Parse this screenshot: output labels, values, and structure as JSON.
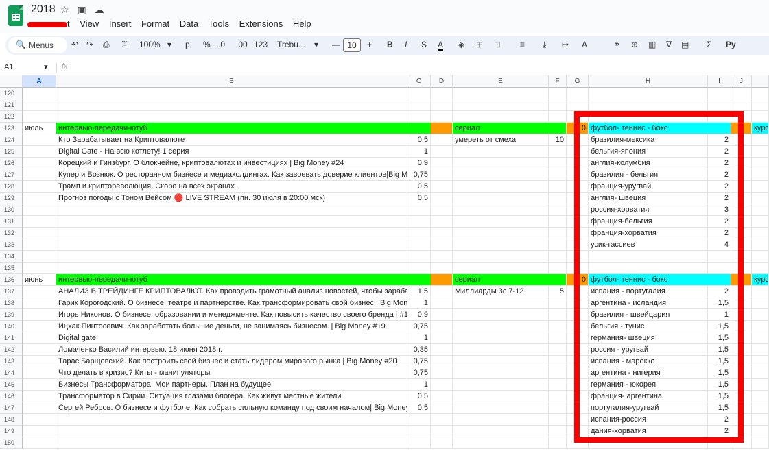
{
  "app": {
    "title": "2018",
    "menus": [
      "t",
      "View",
      "Insert",
      "Format",
      "Data",
      "Tools",
      "Extensions",
      "Help"
    ]
  },
  "toolbar": {
    "search": "Menus",
    "zoom": "100%",
    "p": "р.",
    "percent": "%",
    "dec_dn": ".0",
    "dec_up": ".00",
    "fmt123": "123",
    "font": "Trebu...",
    "font_size": "10",
    "bold": "B",
    "italic": "I",
    "strike": "S",
    "sum": "Σ",
    "lang": "Ру"
  },
  "formula_bar": {
    "cell_ref": "A1",
    "fx": "fx"
  },
  "col_headers": [
    "A",
    "B",
    "C",
    "D",
    "E",
    "F",
    "G",
    "H",
    "I",
    "J"
  ],
  "colors": {
    "green": "#00ff00",
    "orange": "#ff9900",
    "cyan": "#00ffff",
    "highlight": "#ff0000"
  },
  "rows": [
    {
      "n": "120"
    },
    {
      "n": "121"
    },
    {
      "n": "122"
    },
    {
      "n": "123",
      "a": "июль",
      "b": "интервью-передачи-ютуб",
      "e": "сериал",
      "g": "0",
      "h": "футбол- теннис - бокс",
      "k": "курс",
      "fill": "header"
    },
    {
      "n": "124",
      "b": "Кто Зарабатывает на Криптовалюте",
      "c": "0,5",
      "e": "умереть от смеха",
      "f": "10",
      "h": "бразилия-мексика",
      "i": "2"
    },
    {
      "n": "125",
      "b": "Digital Gate - На всю котлету! 1 серия",
      "c": "1",
      "h": "бельгия-япония",
      "i": "2"
    },
    {
      "n": "126",
      "b": "Корецкий и Гинзбург. О блокчейне, криптовалютах и инвестициях | Big Money #24",
      "c": "0,9",
      "h": "англия-колумбия",
      "i": "2"
    },
    {
      "n": "127",
      "b": "Купер и Вознюк. О ресторанном бизнесе и медиахолдингах. Как завоевать доверие клиентов|Big Mo",
      "c": "0,75",
      "h": "бразилия - бельгия",
      "i": "2"
    },
    {
      "n": "128",
      "b": "Трамп и криптореволюция. Скоро на всех экранах..",
      "c": "0,5",
      "h": "франция-уругвай",
      "i": "2"
    },
    {
      "n": "129",
      "b": "Прогноз погоды с Тоном Вейсом 🔴 LIVE STREAM (пн. 30 июля в 20:00 мск)",
      "c": "0,5",
      "h": "англия- швеция",
      "i": "2"
    },
    {
      "n": "130",
      "h": "россия-хорватия",
      "i": "3"
    },
    {
      "n": "131",
      "h": "франция-бельгия",
      "i": "2"
    },
    {
      "n": "132",
      "h": "франция-хорватия",
      "i": "2"
    },
    {
      "n": "133",
      "h": "усик-гассиев",
      "i": "4"
    },
    {
      "n": "134"
    },
    {
      "n": "135"
    },
    {
      "n": "136",
      "a": "июнь",
      "b": "интервью-передачи-ютуб",
      "e": "сериал",
      "g": "0",
      "h": "футбол- теннис - бокс",
      "k": "курс",
      "fill": "header"
    },
    {
      "n": "137",
      "b": "АНАЛИЗ В ТРЕЙДИНГЕ КРИПТОВАЛЮТ. Как проводить грамотный анализ новостей, чтобы зарабать",
      "c": "1,5",
      "e": "Миллиарды 3с 7-12",
      "f": "5",
      "h": "испания - португалия",
      "i": "2"
    },
    {
      "n": "138",
      "b": "Гарик Корогодский. О бизнесе, театре и партнерстве. Как трансформировать свой бизнес | Big Money",
      "c": "1",
      "h": "аргентина - исландия",
      "i": "1,5"
    },
    {
      "n": "139",
      "b": "Игорь Никонов. О бизнесе, образовании и менеджменте. Как повысить качество своего бренда | #18",
      "c": "0,9",
      "h": "бразилия - швейцария",
      "i": "1"
    },
    {
      "n": "140",
      "b": "Ицхак Пинтосевич. Как заработать большие деньги, не занимаясь бизнесом. | Big Money #19",
      "c": "0,75",
      "h": "бельгия - тунис",
      "i": "1,5"
    },
    {
      "n": "141",
      "b": "Digital gate",
      "c": "1",
      "h": "германия- швеция",
      "i": "1,5"
    },
    {
      "n": "142",
      "b": "Ломаченко Василий интервью. 18 июня 2018 г.",
      "c": "0,35",
      "h": "россия - уругвай",
      "i": "1,5"
    },
    {
      "n": "143",
      "b": "Тарас Барщовский. Как построить свой бизнес и стать лидером мирового рынка | Big Money #20",
      "c": "0,75",
      "h": "испания - марокко",
      "i": "1,5"
    },
    {
      "n": "144",
      "b": "Что делать в кризис? Киты - манипуляторы",
      "c": "0,75",
      "h": "аргентина - нигерия",
      "i": "1,5"
    },
    {
      "n": "145",
      "b": "Бизнесы Трансформатора. Мои партнеры. План на будущее",
      "c": "1",
      "h": "германия - юкорея",
      "i": "1,5"
    },
    {
      "n": "146",
      "b": "Трансформатор в Сирии. Ситуация глазами блогера. Как живут местные жители",
      "c": "0,5",
      "h": "франция- аргентина",
      "i": "1,5"
    },
    {
      "n": "147",
      "b": "Сергей Ребров. О бизнесе и футболе. Как собрать сильную команду под своим началом| Big Money #",
      "c": "0,5",
      "h": "португалия-уругвай",
      "i": "1,5"
    },
    {
      "n": "148",
      "h": "испания-россия",
      "i": "2"
    },
    {
      "n": "149",
      "h": "дания-хорватия",
      "i": "2"
    },
    {
      "n": "150"
    }
  ]
}
